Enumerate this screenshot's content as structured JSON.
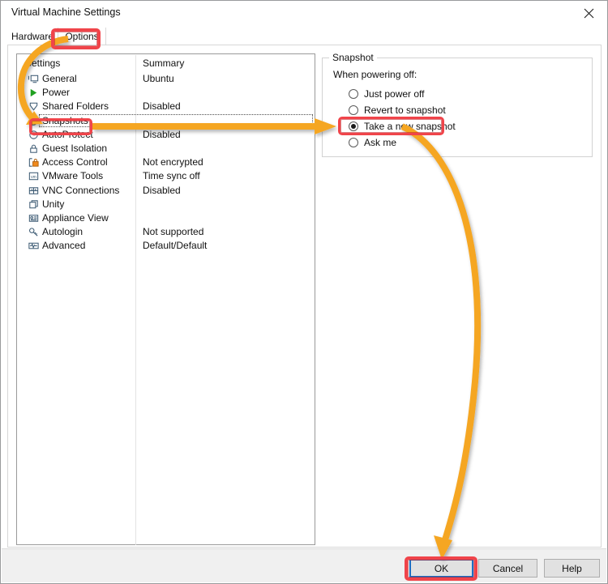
{
  "window": {
    "title": "Virtual Machine Settings",
    "close_icon": "close-icon"
  },
  "tabs": [
    {
      "label": "Hardware",
      "selected": false
    },
    {
      "label": "Options",
      "selected": true
    }
  ],
  "list": {
    "headers": {
      "settings": "Settings",
      "summary": "Summary"
    },
    "rows": [
      {
        "icon": "monitor-icon",
        "label": "General",
        "summary": "Ubuntu",
        "focused": false
      },
      {
        "icon": "play-triangle-icon",
        "label": "Power",
        "summary": "",
        "focused": false
      },
      {
        "icon": "folder-shared-icon",
        "label": "Shared Folders",
        "summary": "Disabled",
        "focused": false
      },
      {
        "icon": "clock-snapshot-icon",
        "label": "Snapshots",
        "summary": "",
        "focused": true
      },
      {
        "icon": "clock-back-icon",
        "label": "AutoProtect",
        "summary": "Disabled",
        "focused": false
      },
      {
        "icon": "padlock-icon",
        "label": "Guest Isolation",
        "summary": "",
        "focused": false
      },
      {
        "icon": "lock-orange-icon",
        "label": "Access Control",
        "summary": "Not encrypted",
        "focused": false
      },
      {
        "icon": "vm-badge-icon",
        "label": "VMware Tools",
        "summary": "Time sync off",
        "focused": false
      },
      {
        "icon": "network-vnc-icon",
        "label": "VNC Connections",
        "summary": "Disabled",
        "focused": false
      },
      {
        "icon": "unity-windows-icon",
        "label": "Unity",
        "summary": "",
        "focused": false
      },
      {
        "icon": "appliance-view-icon",
        "label": "Appliance View",
        "summary": "",
        "focused": false
      },
      {
        "icon": "autologin-key-icon",
        "label": "Autologin",
        "summary": "Not supported",
        "focused": false
      },
      {
        "icon": "waveform-icon",
        "label": "Advanced",
        "summary": "Default/Default",
        "focused": false
      }
    ]
  },
  "snapshot_group": {
    "legend": "Snapshot",
    "caption": "When powering off:",
    "options": [
      {
        "label": "Just power off",
        "checked": false
      },
      {
        "label": "Revert to snapshot",
        "checked": false
      },
      {
        "label": "Take a new snapshot",
        "checked": true
      },
      {
        "label": "Ask me",
        "checked": false
      }
    ]
  },
  "footer": {
    "ok": "OK",
    "cancel": "Cancel",
    "help": "Help"
  },
  "annotations": {
    "highlight_color": "#f0444a",
    "arrow_color": "#f5a623",
    "targets": [
      "Options",
      "Snapshots",
      "Take a new snapshot",
      "OK"
    ]
  }
}
